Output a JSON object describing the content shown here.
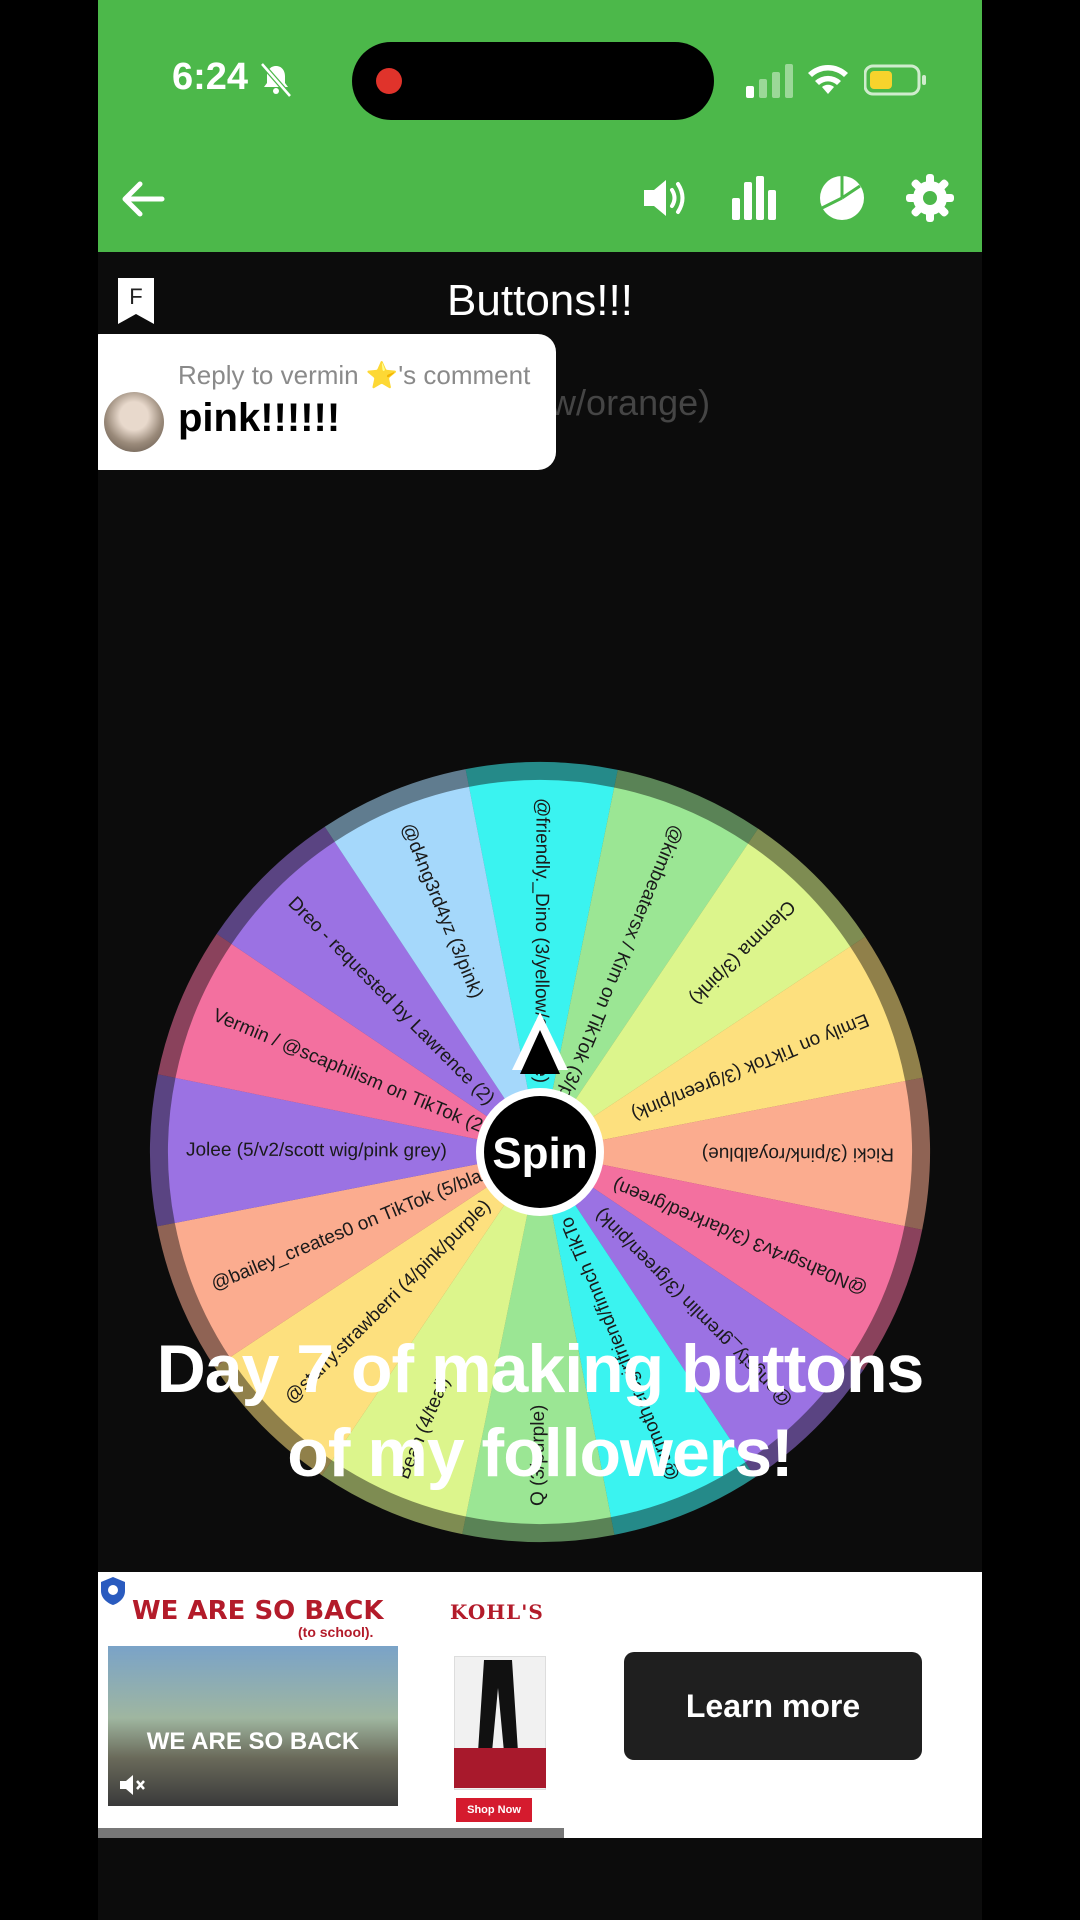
{
  "status_bar": {
    "time": "6:24"
  },
  "header": {
    "title": "Buttons!!!",
    "subtitle_partial": "/yellow/orange)"
  },
  "reply": {
    "label": "Reply to vermin ⭐'s comment",
    "text": "pink!!!!!!"
  },
  "wheel": {
    "center_label": "Spin",
    "segments": [
      {
        "label": "@friendly._Dino (3/yellow/orange)",
        "color": "#3af3f0"
      },
      {
        "label": "@kimbeatersx / Kim on TikTok (3/p",
        "color": "#9be694"
      },
      {
        "label": "Clemma (3/pink)",
        "color": "#dcf58c"
      },
      {
        "label": "Emily on TikTok (3/green/pink)",
        "color": "#fde07e"
      },
      {
        "label": "Ricki (3/pink/royalblue)",
        "color": "#fbac8f"
      },
      {
        "label": "@N0ahsgr4v3 (3/darkred/green)",
        "color": "#f3709f"
      },
      {
        "label": "@angsty_gremlin (3/green/pink)",
        "color": "#9b72e3"
      },
      {
        "label": "@urmothersgirlfriend/finnch TikTo",
        "color": "#3af3f0"
      },
      {
        "label": "Q (3/purple)",
        "color": "#9be694"
      },
      {
        "label": "Bean (4/teal)",
        "color": "#dcf58c"
      },
      {
        "label": "@starry.strawberri (4/pink/purple)",
        "color": "#fde07e"
      },
      {
        "label": "@bailey_creates0 on TikTok (5/bla",
        "color": "#fbac8f"
      },
      {
        "label": "Jolee (5/v2/scott wig/pink grey)",
        "color": "#9b72e3"
      },
      {
        "label": "Vermin / @scaphilism on TikTok (2/",
        "color": "#f3709f"
      },
      {
        "label": "Dreo - requested by Lawrence (2)",
        "color": "#9b72e3"
      },
      {
        "label": "@d4ng3rd4yz (3/pink)",
        "color": "#a5d8fb"
      }
    ]
  },
  "caption": {
    "line1": "Day 7 of making buttons",
    "line2": "of my followers!"
  },
  "ad": {
    "headline": "WE ARE SO BACK",
    "subline": "(to school).",
    "brand": "KOHL'S",
    "photo_text": "WE ARE SO BACK",
    "shop_label": "Shop Now",
    "cta": "Learn more"
  },
  "colors": {
    "topbar": "#4cb84a",
    "background": "#0c0c0c",
    "ad_red": "#b31b2a"
  }
}
